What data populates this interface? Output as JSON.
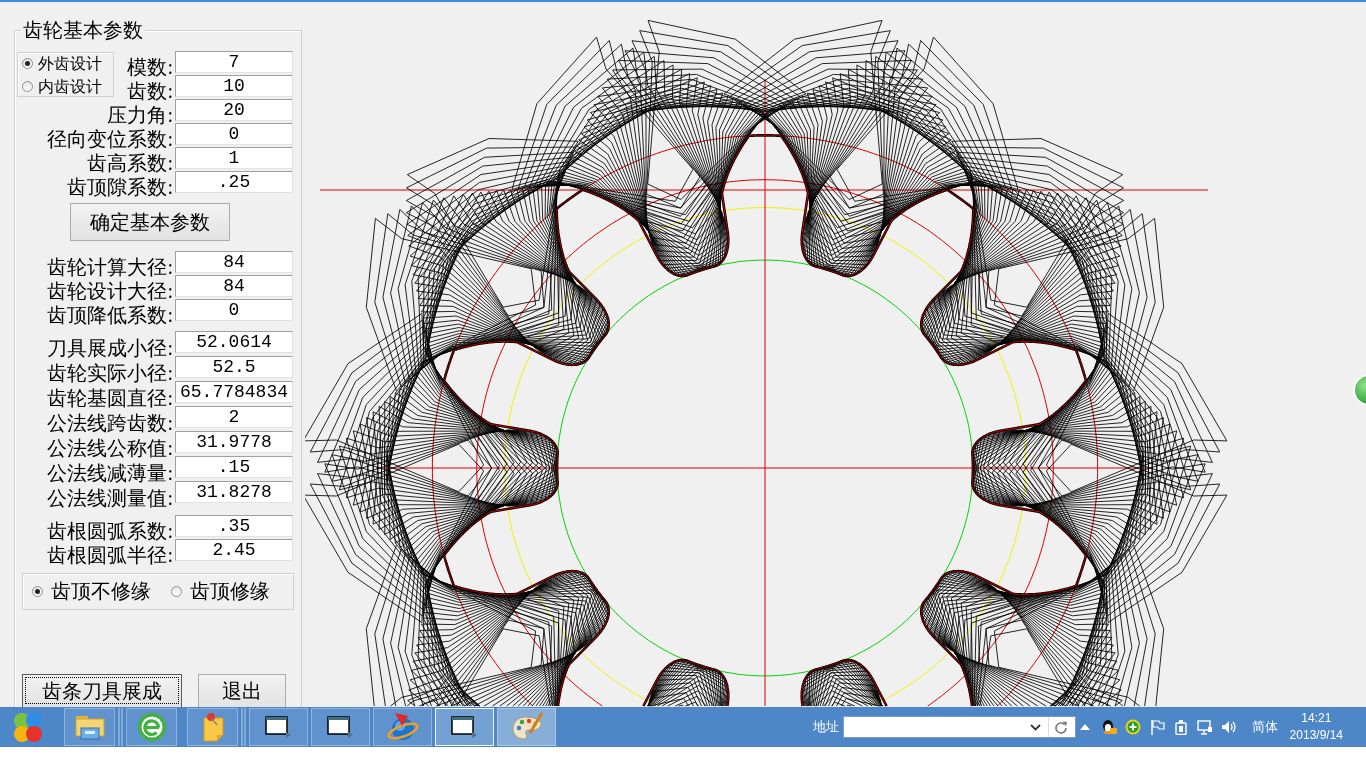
{
  "panel": {
    "title": "齿轮基本参数",
    "design_types": [
      {
        "label": "外齿设计",
        "selected": true
      },
      {
        "label": "内齿设计",
        "selected": false
      }
    ],
    "basic_fields": [
      {
        "label": "模数:",
        "value": "7"
      },
      {
        "label": "齿数:",
        "value": "10"
      },
      {
        "label": "压力角:",
        "value": "20"
      },
      {
        "label": "径向变位系数:",
        "value": "0"
      },
      {
        "label": "齿高系数:",
        "value": "1"
      },
      {
        "label": "齿顶隙系数:",
        "value": ".25"
      }
    ],
    "confirm_button": "确定基本参数",
    "result_sections": [
      [
        {
          "label": "齿轮计算大径:",
          "value": "84"
        },
        {
          "label": "齿轮设计大径:",
          "value": "84"
        },
        {
          "label": "齿顶降低系数:",
          "value": "0"
        }
      ],
      [
        {
          "label": "刀具展成小径:",
          "value": "52.0614"
        },
        {
          "label": "齿轮实际小径:",
          "value": "52.5"
        },
        {
          "label": "齿轮基圆直径:",
          "value": "65.7784834"
        },
        {
          "label": "公法线跨齿数:",
          "value": "2"
        },
        {
          "label": "公法线公称值:",
          "value": "31.9778"
        },
        {
          "label": "公法线减薄量:",
          "value": ".15"
        },
        {
          "label": "公法线测量值:",
          "value": "31.8278"
        }
      ],
      [
        {
          "label": "齿根圆弧系数:",
          "value": ".35"
        },
        {
          "label": "齿根圆弧半径:",
          "value": "2.45"
        }
      ]
    ],
    "tip_options": [
      {
        "label": "齿顶不修缘",
        "selected": true
      },
      {
        "label": "齿顶修缘",
        "selected": false
      }
    ],
    "buttons": [
      {
        "label": "齿条刀具展成",
        "focused": true
      },
      {
        "label": "退出",
        "focused": false
      }
    ]
  },
  "taskbar": {
    "button_groups": [
      {
        "kind": "pinned",
        "buttons": [
          {
            "kind": "folder",
            "active": false,
            "hovered": false
          }
        ]
      },
      {
        "kind": "pinned",
        "buttons": [
          {
            "kind": "browser",
            "active": false,
            "hovered": false
          },
          {
            "kind": "note",
            "active": false,
            "hovered": false
          }
        ]
      },
      {
        "kind": "running",
        "buttons": [
          {
            "kind": "window",
            "active": false,
            "hovered": false
          },
          {
            "kind": "window",
            "active": false,
            "hovered": false
          },
          {
            "kind": "globe",
            "active": false,
            "hovered": false
          },
          {
            "kind": "window",
            "active": true,
            "hovered": false
          },
          {
            "kind": "palette",
            "active": false,
            "hovered": true
          }
        ]
      }
    ],
    "address_label": "地址",
    "language": "简体",
    "time": "14:21",
    "date": "2013/9/14"
  }
}
